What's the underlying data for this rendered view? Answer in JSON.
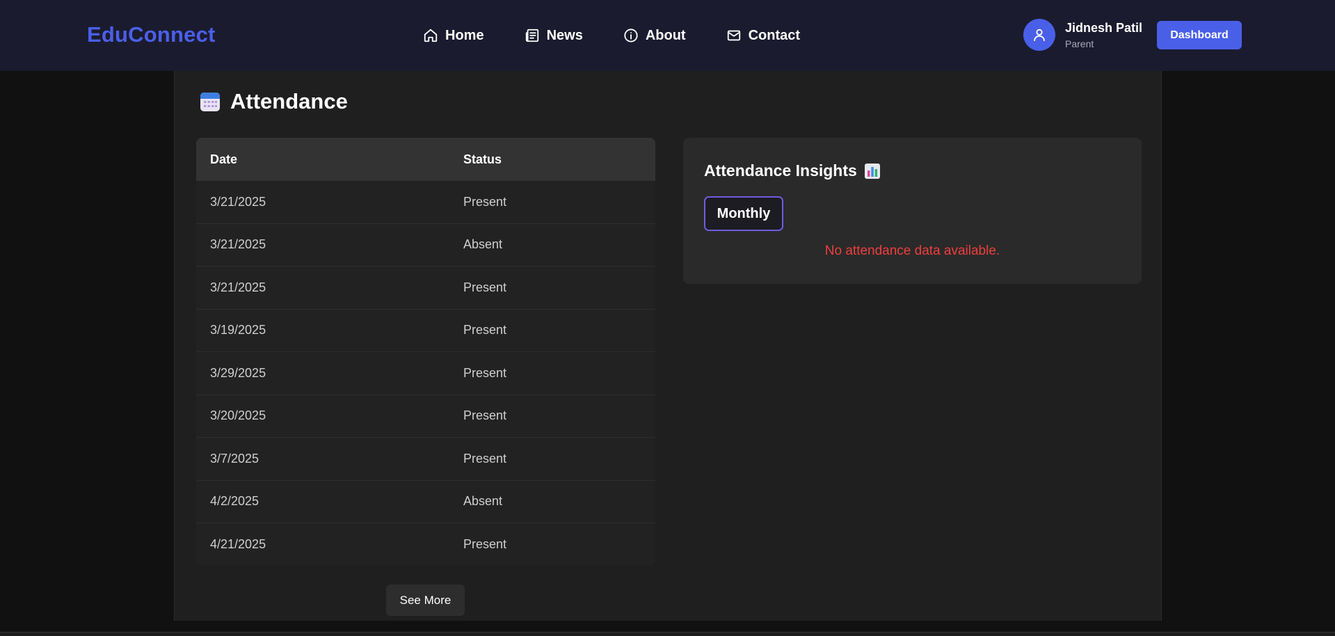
{
  "navbar": {
    "brand": "EduConnect",
    "links": [
      {
        "label": "Home",
        "icon": "home-icon"
      },
      {
        "label": "News",
        "icon": "newspaper-icon"
      },
      {
        "label": "About",
        "icon": "info-icon"
      },
      {
        "label": "Contact",
        "icon": "mail-icon"
      }
    ],
    "user": {
      "name": "Jidnesh Patil",
      "role": "Parent",
      "icon": "user-icon"
    },
    "dashboard_label": "Dashboard"
  },
  "colors": {
    "accent": "#4a5fe8",
    "nav_bg": "#1b1b2f",
    "error": "#ef3e3e",
    "monthly_border": "#6f5ce0"
  },
  "page": {
    "title": "Attendance",
    "title_icon": "calendar-icon"
  },
  "attendance_table": {
    "headers": {
      "date": "Date",
      "status": "Status"
    },
    "rows": [
      {
        "date": "3/21/2025",
        "status": "Present"
      },
      {
        "date": "3/21/2025",
        "status": "Absent"
      },
      {
        "date": "3/21/2025",
        "status": "Present"
      },
      {
        "date": "3/19/2025",
        "status": "Present"
      },
      {
        "date": "3/29/2025",
        "status": "Present"
      },
      {
        "date": "3/20/2025",
        "status": "Present"
      },
      {
        "date": "3/7/2025",
        "status": "Present"
      },
      {
        "date": "4/2/2025",
        "status": "Absent"
      },
      {
        "date": "4/21/2025",
        "status": "Present"
      }
    ],
    "see_more_label": "See More"
  },
  "insights": {
    "title": "Attendance Insights",
    "title_icon": "bar-chart-icon",
    "period_button": "Monthly",
    "empty_message": "No attendance data available."
  }
}
